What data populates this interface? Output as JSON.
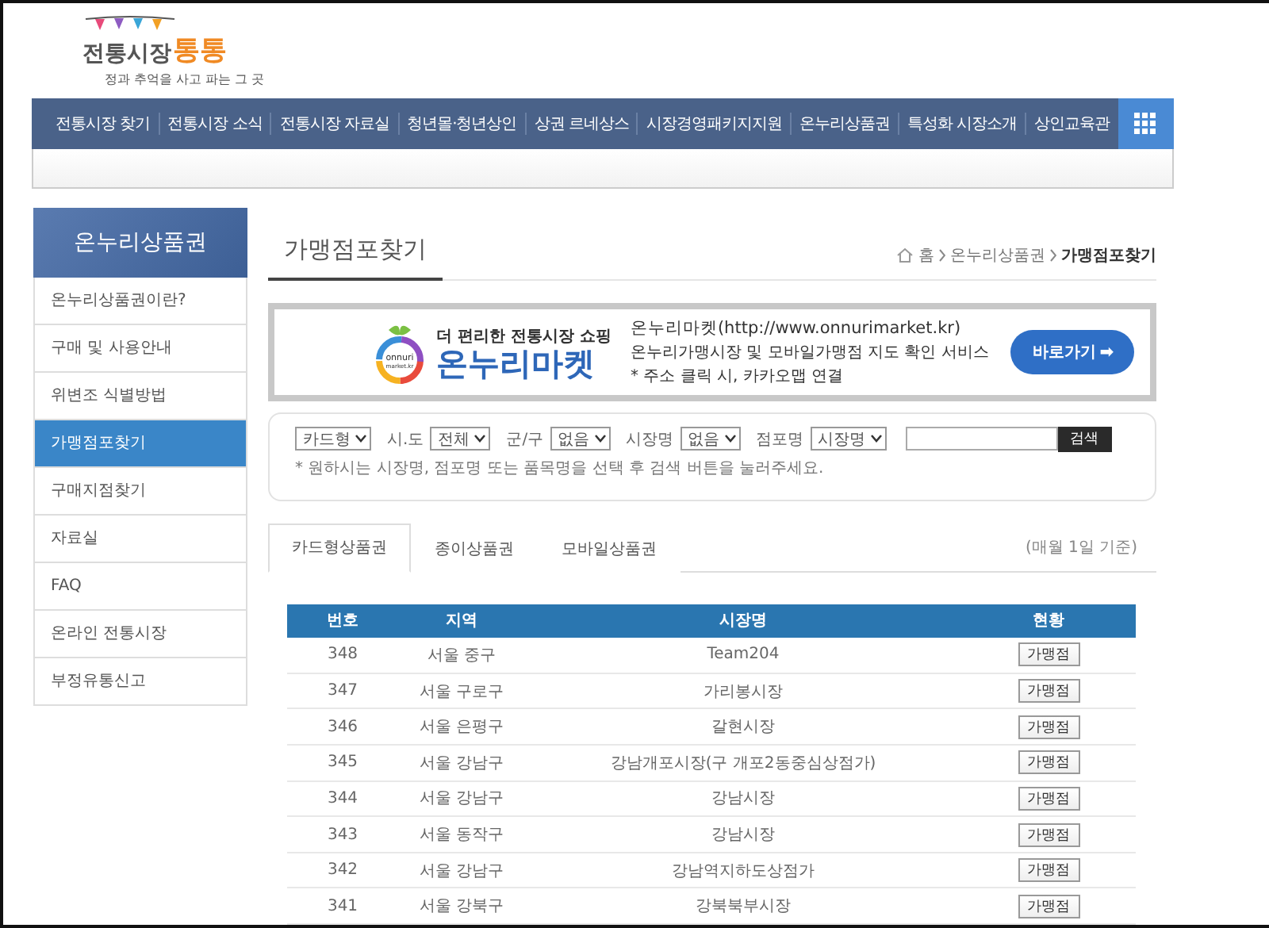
{
  "logo": {
    "name": "전통시장",
    "accent": "통통",
    "tagline": "정과 추억을 사고 파는 그 곳"
  },
  "nav": {
    "items": [
      "전통시장 찾기",
      "전통시장 소식",
      "전통시장 자료실",
      "청년몰·청년상인",
      "상권 르네상스",
      "시장경영패키지지원",
      "온누리상품권",
      "특성화 시장소개",
      "상인교육관"
    ]
  },
  "sidebar": {
    "title": "온누리상품권",
    "items": [
      {
        "label": "온누리상품권이란?",
        "selected": false
      },
      {
        "label": "구매 및 사용안내",
        "selected": false
      },
      {
        "label": "위변조 식별방법",
        "selected": false
      },
      {
        "label": "가맹점포찾기",
        "selected": true
      },
      {
        "label": "구매지점찾기",
        "selected": false
      },
      {
        "label": "자료실",
        "selected": false
      },
      {
        "label": "FAQ",
        "selected": false
      },
      {
        "label": "온라인 전통시장",
        "selected": false
      },
      {
        "label": "부정유통신고",
        "selected": false
      }
    ]
  },
  "page_title": "가맹점포찾기",
  "breadcrumb": [
    "홈",
    "온누리상품권",
    "가맹점포찾기"
  ],
  "banner": {
    "logo_text": [
      "onnuri",
      "market.kr"
    ],
    "slogan": "더 편리한 전통시장 쇼핑",
    "brand": "온누리마켓",
    "lines": [
      "온누리마켓(http://www.onnurimarket.kr)",
      "온누리가맹시장 및 모바일가맹점 지도 확인 서비스",
      "* 주소 클릭 시, 카카오맵 연결"
    ],
    "button": "바로가기 ➡"
  },
  "search": {
    "filters": [
      {
        "value": "카드형"
      },
      {
        "label": "시.도",
        "value": "전체"
      },
      {
        "label": "군/구",
        "value": "없음"
      },
      {
        "label": "시장명",
        "value": "없음"
      },
      {
        "label": "점포명",
        "value": "시장명"
      }
    ],
    "button": "검색",
    "hint": "* 원하시는 시장명, 점포명 또는 품목명을 선택 후 검색 버튼을 눌러주세요."
  },
  "tabs": [
    {
      "label": "카드형상품권",
      "selected": true
    },
    {
      "label": "종이상품권",
      "selected": false
    },
    {
      "label": "모바일상품권",
      "selected": false
    }
  ],
  "tabs_note": "(매월 1일 기준)",
  "table": {
    "columns": [
      "번호",
      "지역",
      "시장명",
      "현황"
    ],
    "rows": [
      [
        "348",
        "서울 중구",
        "Team204",
        "가맹점"
      ],
      [
        "347",
        "서울 구로구",
        "가리봉시장",
        "가맹점"
      ],
      [
        "346",
        "서울 은평구",
        "갈현시장",
        "가맹점"
      ],
      [
        "345",
        "서울 강남구",
        "강남개포시장(구 개포2동중심상점가)",
        "가맹점"
      ],
      [
        "344",
        "서울 강남구",
        "강남시장",
        "가맹점"
      ],
      [
        "343",
        "서울 동작구",
        "강남시장",
        "가맹점"
      ],
      [
        "342",
        "서울 강남구",
        "강남역지하도상점가",
        "가맹점"
      ],
      [
        "341",
        "서울 강북구",
        "강북북부시장",
        "가맹점"
      ]
    ]
  }
}
